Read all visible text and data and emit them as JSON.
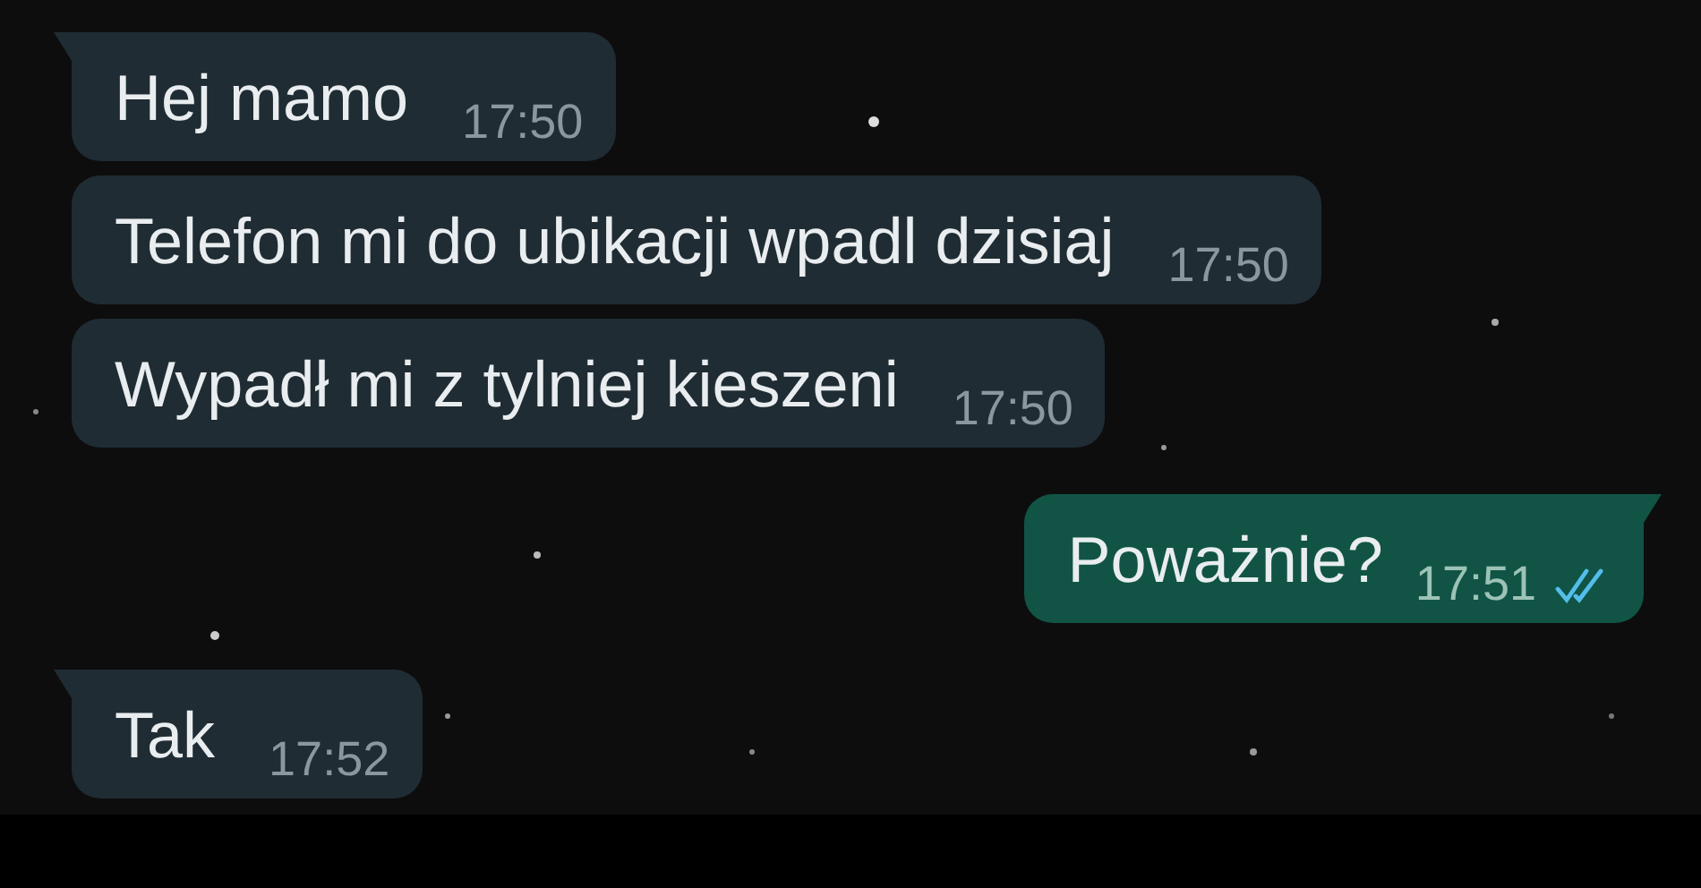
{
  "messages": [
    {
      "kind": "incoming",
      "tail": true,
      "text": "Hej mamo",
      "time": "17:50"
    },
    {
      "kind": "incoming",
      "tail": false,
      "text": "Telefon mi do ubikacji wpadl dzisiaj",
      "time": "17:50"
    },
    {
      "kind": "incoming",
      "tail": false,
      "text": "Wypadł mi z tylniej kieszeni",
      "time": "17:50"
    },
    {
      "kind": "outgoing",
      "tail": true,
      "text": "Poważnie?",
      "time": "17:51",
      "read": true
    },
    {
      "kind": "incoming",
      "tail": true,
      "text": "Tak",
      "time": "17:52"
    }
  ]
}
